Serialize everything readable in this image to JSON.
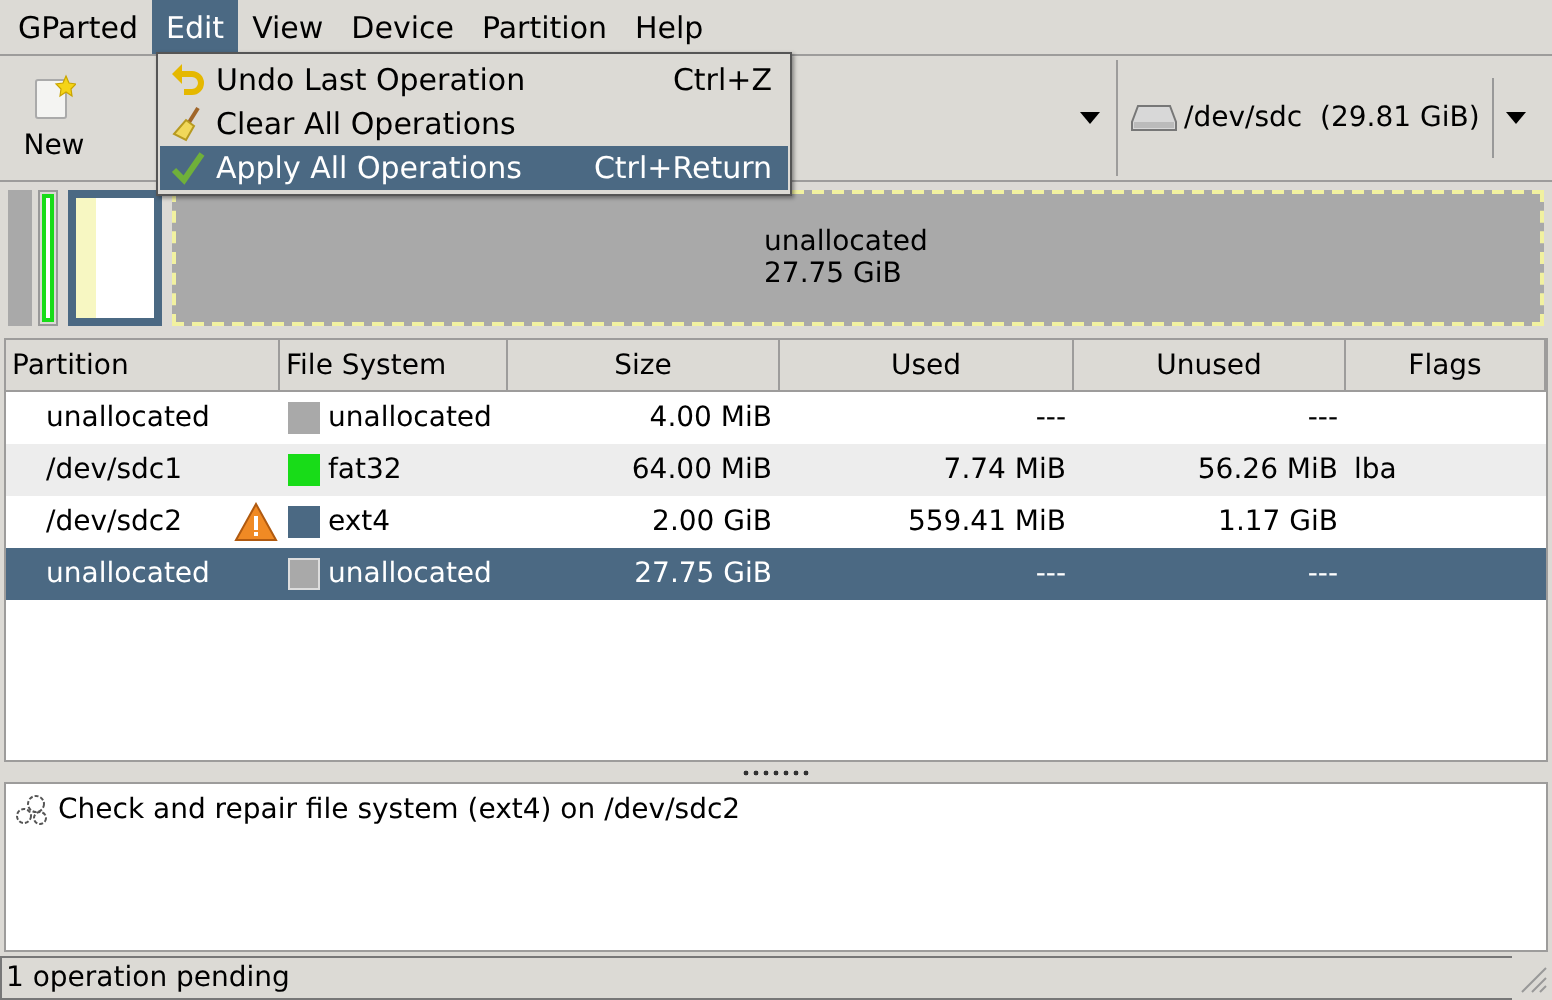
{
  "menubar": [
    {
      "label": "GParted",
      "selected": false
    },
    {
      "label": "Edit",
      "selected": true
    },
    {
      "label": "View",
      "selected": false
    },
    {
      "label": "Device",
      "selected": false
    },
    {
      "label": "Partition",
      "selected": false
    },
    {
      "label": "Help",
      "selected": false
    }
  ],
  "edit_menu": [
    {
      "label": "Undo Last Operation",
      "shortcut": "Ctrl+Z",
      "selected": false
    },
    {
      "label": "Clear All Operations",
      "selected": false
    },
    {
      "label": "Apply All Operations",
      "shortcut": "Ctrl+Return",
      "selected": true
    }
  ],
  "toolbar": {
    "new_label": "New"
  },
  "device": {
    "label": "/dev/sdc  (29.81 GiB)"
  },
  "disk_map": {
    "selected_label": "unallocated",
    "selected_size": "27.75 GiB"
  },
  "table": {
    "columns": [
      "Partition",
      "File System",
      "Size",
      "Used",
      "Unused",
      "Flags"
    ],
    "rows": [
      {
        "partition": "unallocated",
        "warning": false,
        "color": "#a9a9a9",
        "fs": "unallocated",
        "size": "4.00 MiB",
        "used": "---",
        "unused": "---",
        "selected": false
      },
      {
        "partition": "/dev/sdc1",
        "warning": false,
        "color": "#18dc18",
        "fs": "fat32",
        "size": "64.00 MiB",
        "used": "7.74 MiB",
        "unused": "56.26 MiB",
        "flags": "lba",
        "selected": false
      },
      {
        "partition": "/dev/sdc2",
        "warning": true,
        "color": "#4b6983",
        "fs": "ext4",
        "size": "2.00 GiB",
        "used": "559.41 MiB",
        "unused": "1.17 GiB",
        "selected": false
      },
      {
        "partition": "unallocated",
        "warning": false,
        "color": "#a9a9a9",
        "fs": "unallocated",
        "size": "27.75 GiB",
        "used": "---",
        "unused": "---",
        "selected": true
      }
    ]
  },
  "operations": [
    "Check and repair file system (ext4) on /dev/sdc2"
  ],
  "status_bar": "1 operation pending"
}
